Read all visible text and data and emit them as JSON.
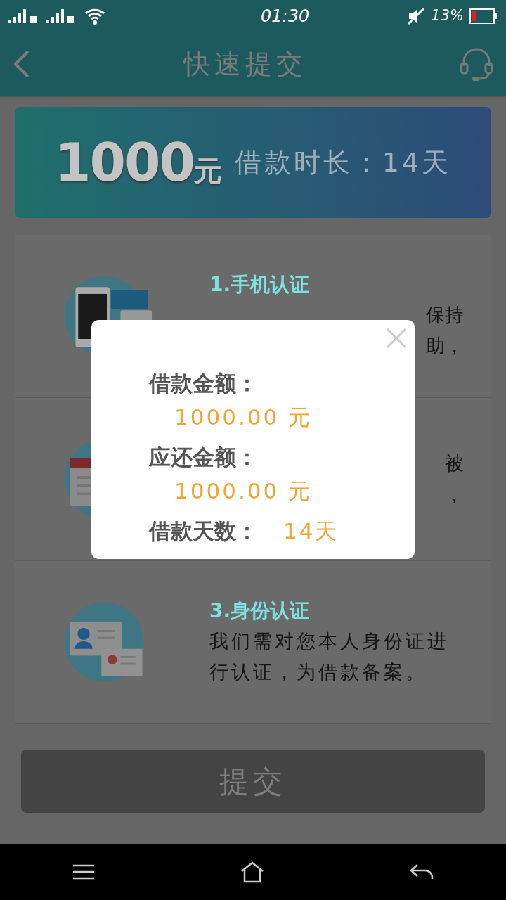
{
  "status_bar": {
    "time": "01:30",
    "battery": "13%"
  },
  "header": {
    "title": "快速提交"
  },
  "banner": {
    "amount": "1000",
    "unit": "元",
    "duration": "借款时长：14天"
  },
  "cards": [
    {
      "kind": "phone",
      "title": "1.手机认证",
      "lines": [
        "保持",
        "助，"
      ]
    },
    {
      "kind": "report",
      "lines": [
        "被",
        "，"
      ]
    },
    {
      "kind": "id",
      "title": "3.身份认证",
      "lines": [
        "我们需对您本人身份证进",
        "行认证，为借款备案。"
      ]
    }
  ],
  "submit": {
    "label": "提交",
    "disabled": true
  },
  "dialog": {
    "rows": [
      {
        "label": "借款金额：",
        "value": "1000.00 元"
      },
      {
        "label": "应还金额：",
        "value": "1000.00 元"
      },
      {
        "label": "借款天数：",
        "value": "14天"
      }
    ]
  }
}
